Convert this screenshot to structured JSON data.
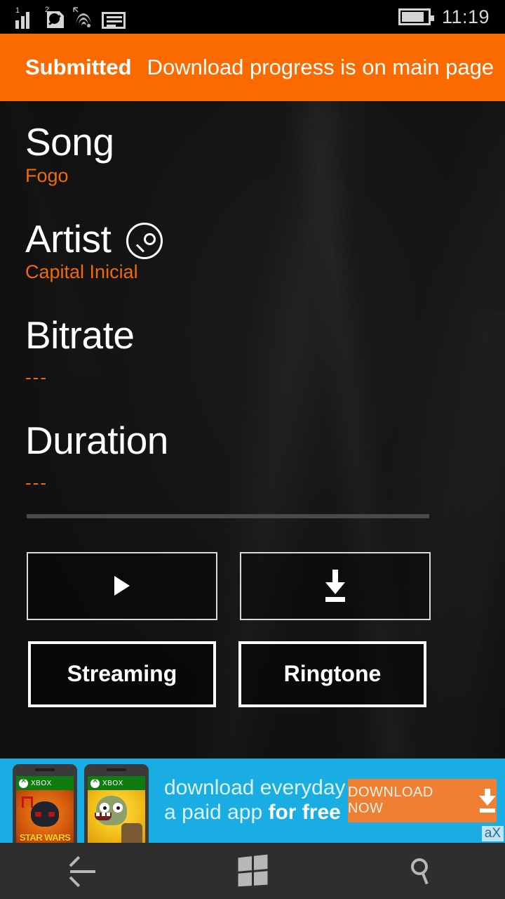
{
  "status_bar": {
    "signal_label": "1",
    "sim_label": "2",
    "icons": [
      "signal-bars-icon",
      "sim-data-icon",
      "wifi-icon",
      "sms-message-icon",
      "battery-icon"
    ],
    "time": "11:19"
  },
  "toast": {
    "title": "Submitted",
    "message": "Download progress is on main page",
    "background": "#fb6a01"
  },
  "fields": [
    {
      "label": "Song",
      "value": "Fogo",
      "has_search": false
    },
    {
      "label": "Artist",
      "value": "Capital Inicial",
      "has_search": true
    },
    {
      "label": "Bitrate",
      "value": "---",
      "has_search": false
    },
    {
      "label": "Duration",
      "value": "---",
      "has_search": false
    }
  ],
  "actions": {
    "play_icon": "play-icon",
    "download_icon": "download-icon",
    "streaming_label": "Streaming",
    "ringtone_label": "Ringtone"
  },
  "ad": {
    "line1": "download everyday",
    "line2_normal": "a paid app ",
    "line2_bold": "for free",
    "cta_label": "DOWNLOAD NOW",
    "badge": "aX",
    "background": "#1aade3",
    "cta_background": "#ef8033",
    "thumb1_store": "XBOX",
    "thumb1_title": "STAR WARS",
    "thumb2_store": "XBOX"
  },
  "nav_bar": {
    "back_label": "back-arrow-icon",
    "start_label": "windows-start-icon",
    "search_label": "search-icon"
  },
  "theme": {
    "accent_orange": "#ee6a0a",
    "header_orange": "#fb6a01",
    "background_dark": "#151515",
    "text_white": "#ffffff",
    "ad_blue": "#1aade3"
  }
}
